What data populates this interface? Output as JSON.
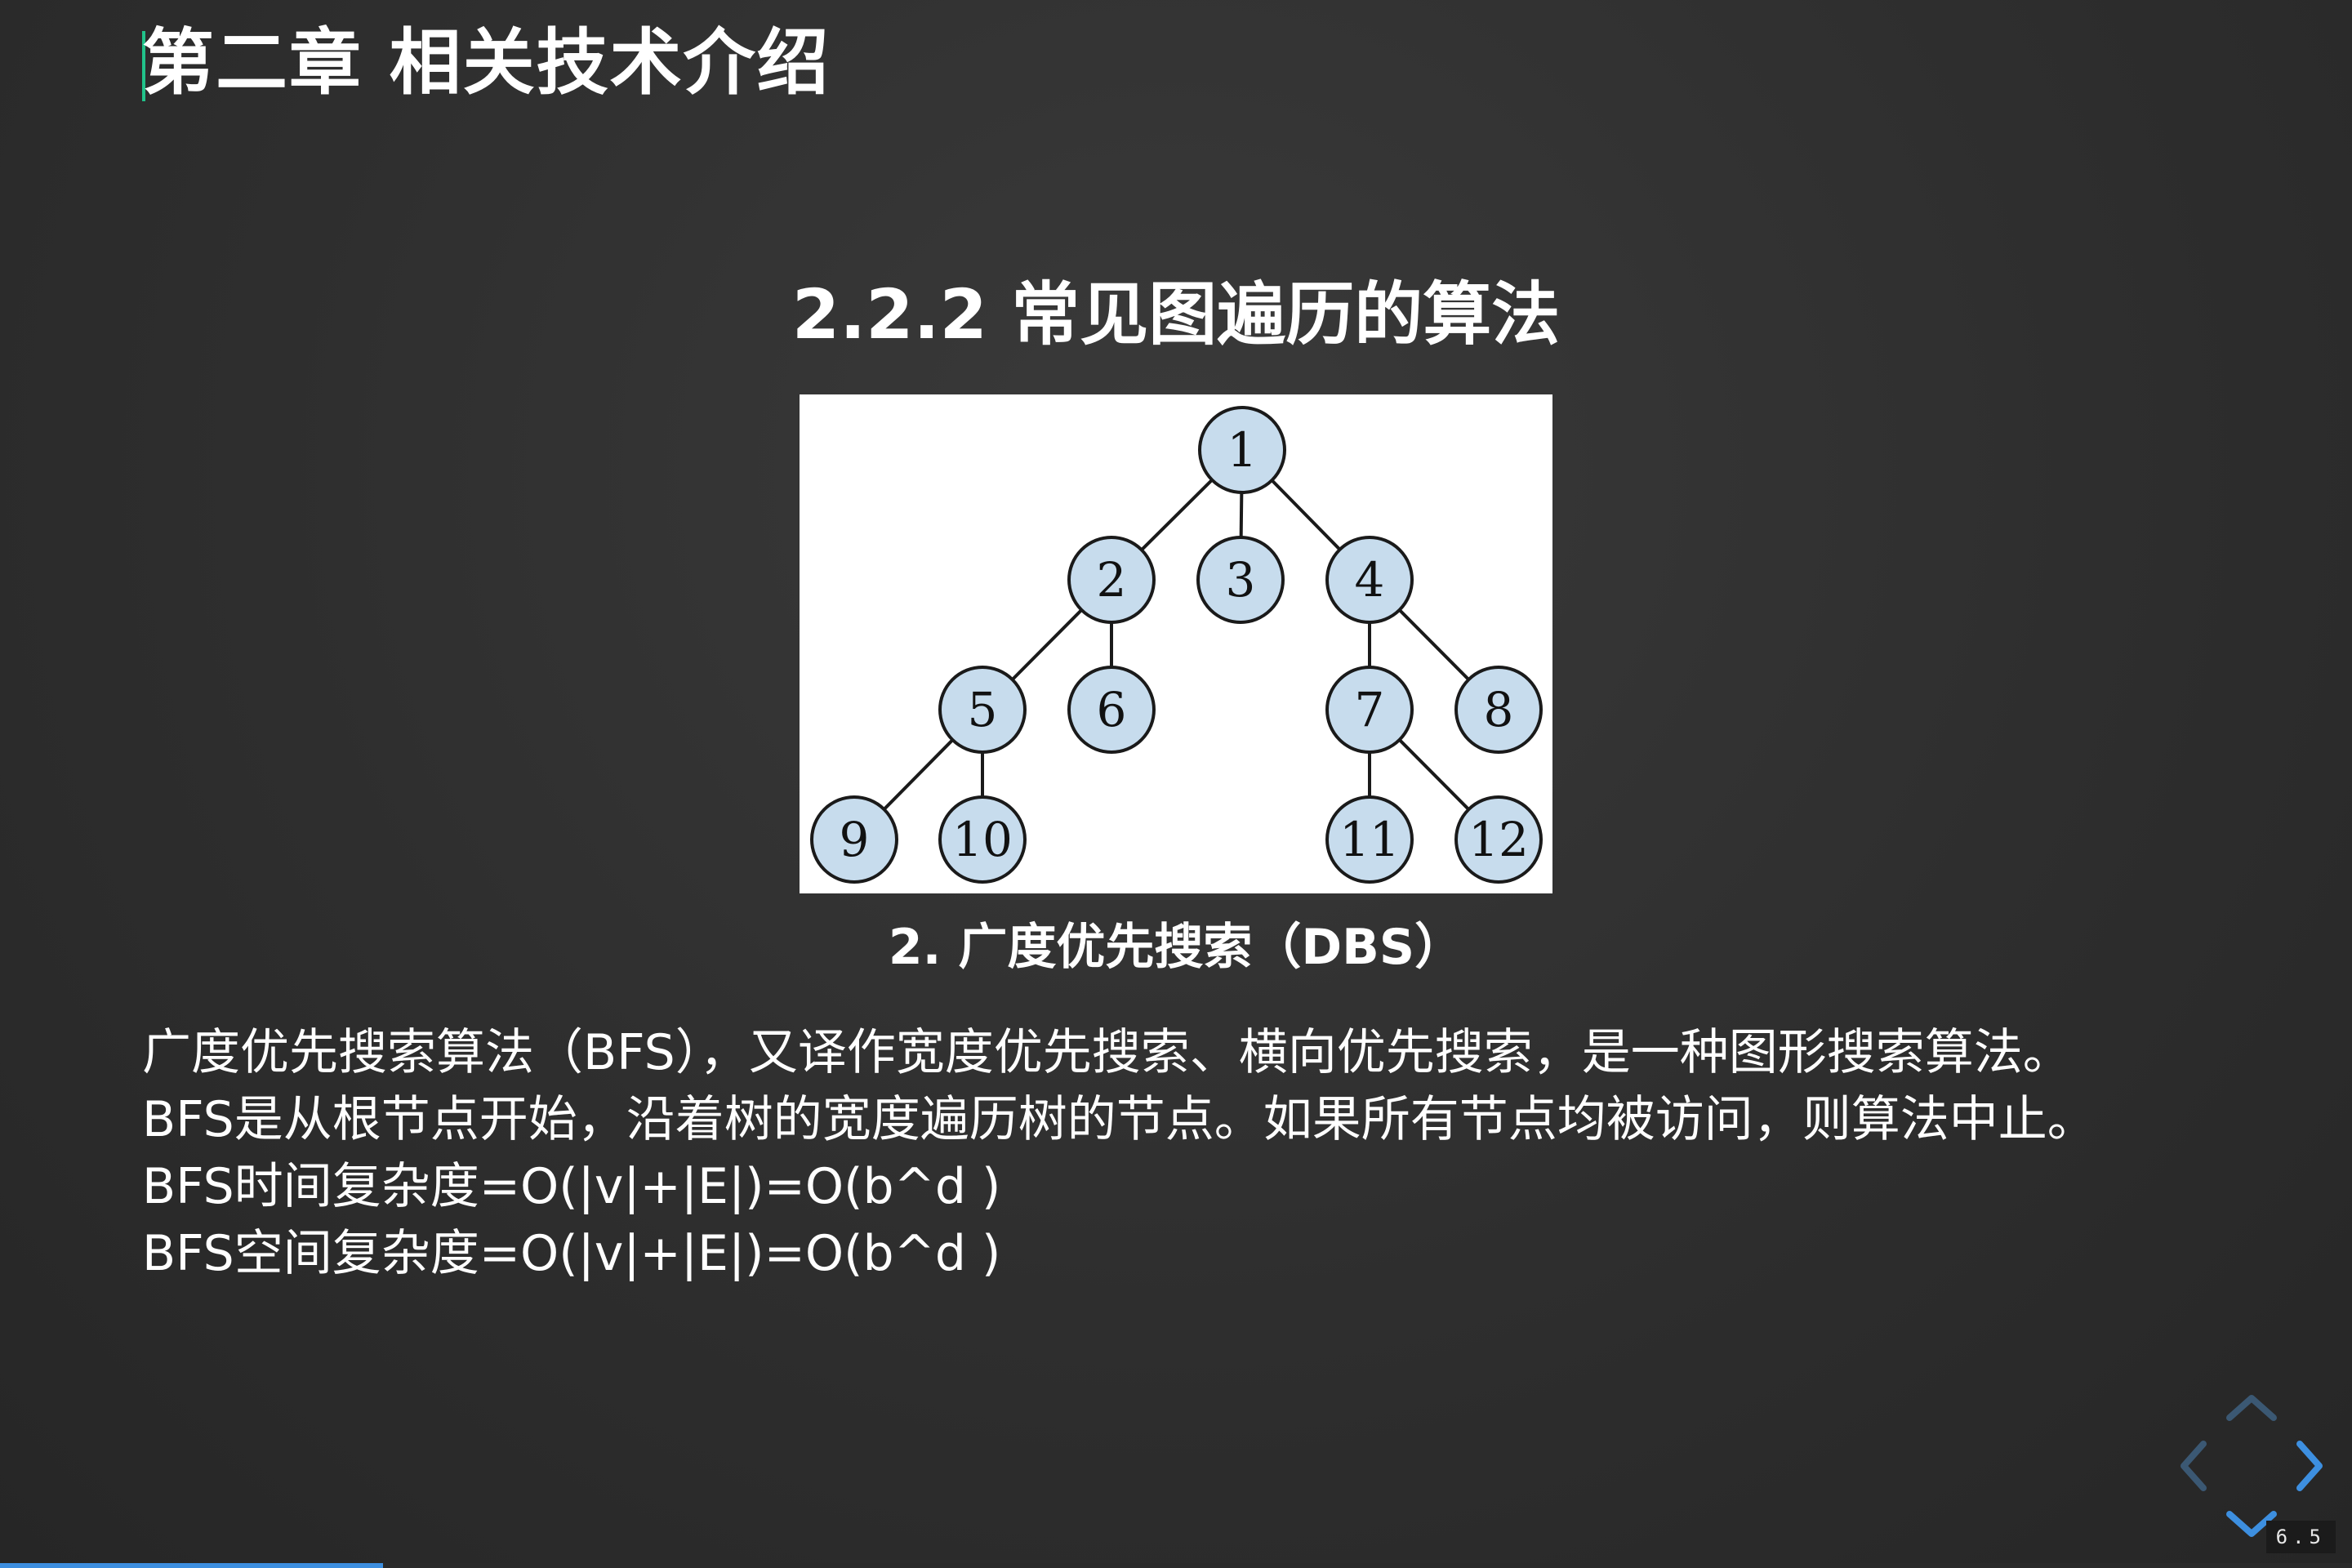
{
  "slide": {
    "chapter_title": "第二章 相关技术介绍",
    "section_title": "2.2.2 常见图遍历的算法",
    "caption": "2. 广度优先搜索（DBS）",
    "body_lines": [
      "广度优先搜索算法（BFS），又译作宽度优先搜索、横向优先搜索，是一种图形搜索算法。",
      "BFS是从根节点开始，沿着树的宽度遍历树的节点。如果所有节点均被访问，则算法中止。",
      "BFS时间复杂度=O(|v|+|E|)=O(b^d )",
      "BFS空间复杂度=O(|v|+|E|)=O(b^d )"
    ],
    "page_number": "6.5",
    "progress": 0.163
  },
  "tree": {
    "nodes": [
      "1",
      "2",
      "3",
      "4",
      "5",
      "6",
      "7",
      "8",
      "9",
      "10",
      "11",
      "12"
    ],
    "edges": [
      [
        "1",
        "2"
      ],
      [
        "1",
        "3"
      ],
      [
        "1",
        "4"
      ],
      [
        "2",
        "5"
      ],
      [
        "2",
        "6"
      ],
      [
        "4",
        "7"
      ],
      [
        "4",
        "8"
      ],
      [
        "5",
        "9"
      ],
      [
        "5",
        "10"
      ],
      [
        "7",
        "11"
      ],
      [
        "7",
        "12"
      ]
    ],
    "node_fill": "#c7dced"
  },
  "navigation": {
    "icons": [
      "chevron-up-icon",
      "chevron-left-icon",
      "chevron-right-icon",
      "chevron-down-icon"
    ],
    "accent_color": "#3d8fe0"
  },
  "colors": {
    "background": "#2f2f2f",
    "chapter_accent": "#21c28a",
    "progress": "#3d8fe0"
  }
}
